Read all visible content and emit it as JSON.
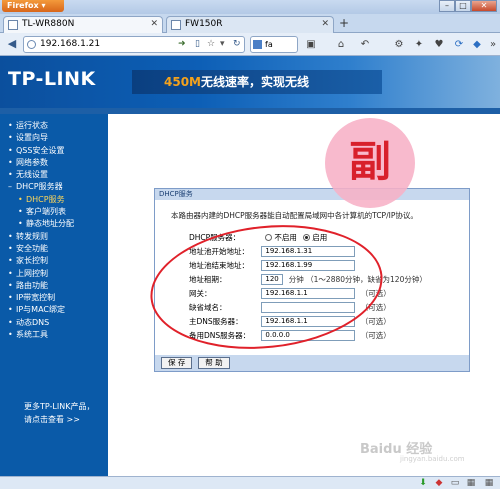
{
  "browser": {
    "app_button": "Firefox",
    "tabs": [
      {
        "label": "TL-WR880N"
      },
      {
        "label": "FW150R"
      }
    ],
    "new_tab": "+",
    "url": "192.168.1.21",
    "search_text": "fa"
  },
  "banner": {
    "logo": "TP-LINK",
    "slogan_highlight": "450M",
    "slogan_rest": "无线速率，实现无线"
  },
  "sidebar": {
    "items": [
      {
        "label": "运行状态"
      },
      {
        "label": "设置向导"
      },
      {
        "label": "QSS安全设置"
      },
      {
        "label": "网络参数"
      },
      {
        "label": "无线设置"
      },
      {
        "label": "DHCP服务器",
        "expanded": true
      },
      {
        "label": "DHCP服务",
        "sub": true,
        "active": true
      },
      {
        "label": "客户端列表",
        "sub": true
      },
      {
        "label": "静态地址分配",
        "sub": true
      },
      {
        "label": "转发规则"
      },
      {
        "label": "安全功能"
      },
      {
        "label": "家长控制"
      },
      {
        "label": "上网控制"
      },
      {
        "label": "路由功能"
      },
      {
        "label": "IP带宽控制"
      },
      {
        "label": "IP与MAC绑定"
      },
      {
        "label": "动态DNS"
      },
      {
        "label": "系统工具"
      }
    ],
    "more_line1": "更多TP-LINK产品，",
    "more_line2": "请点击查看 >>"
  },
  "dhcp": {
    "title": "DHCP服务",
    "intro": "本路由器内建的DHCP服务器能自动配置局域网中各计算机的TCP/IP协议。",
    "server_label": "DHCP服务器：",
    "off_label": "不启用",
    "on_label": "启用",
    "server_enabled": true,
    "start_label": "地址池开始地址：",
    "start_value": "192.168.1.31",
    "end_label": "地址池结束地址：",
    "end_value": "192.168.1.99",
    "lease_label": "地址租期：",
    "lease_value": "120",
    "lease_note": "分钟 （1～2880分钟，缺省为120分钟）",
    "gateway_label": "网关：",
    "gateway_value": "192.168.1.1",
    "optional": "（可选）",
    "domain_label": "缺省域名：",
    "domain_value": "",
    "dns1_label": "主DNS服务器：",
    "dns1_value": "192.168.1.1",
    "dns2_label": "备用DNS服务器：",
    "dns2_value": "0.0.0.0",
    "save_label": "保 存",
    "help_label": "帮 助"
  },
  "overlay": {
    "stamp": "副",
    "watermark": "Baidu 经验",
    "watermark_sub": "jingyan.baidu.com"
  },
  "colors": {
    "sidebar_bg": "#0a5aa8",
    "banner_accent": "#f4a21c",
    "annotation_red": "#e0212a"
  }
}
